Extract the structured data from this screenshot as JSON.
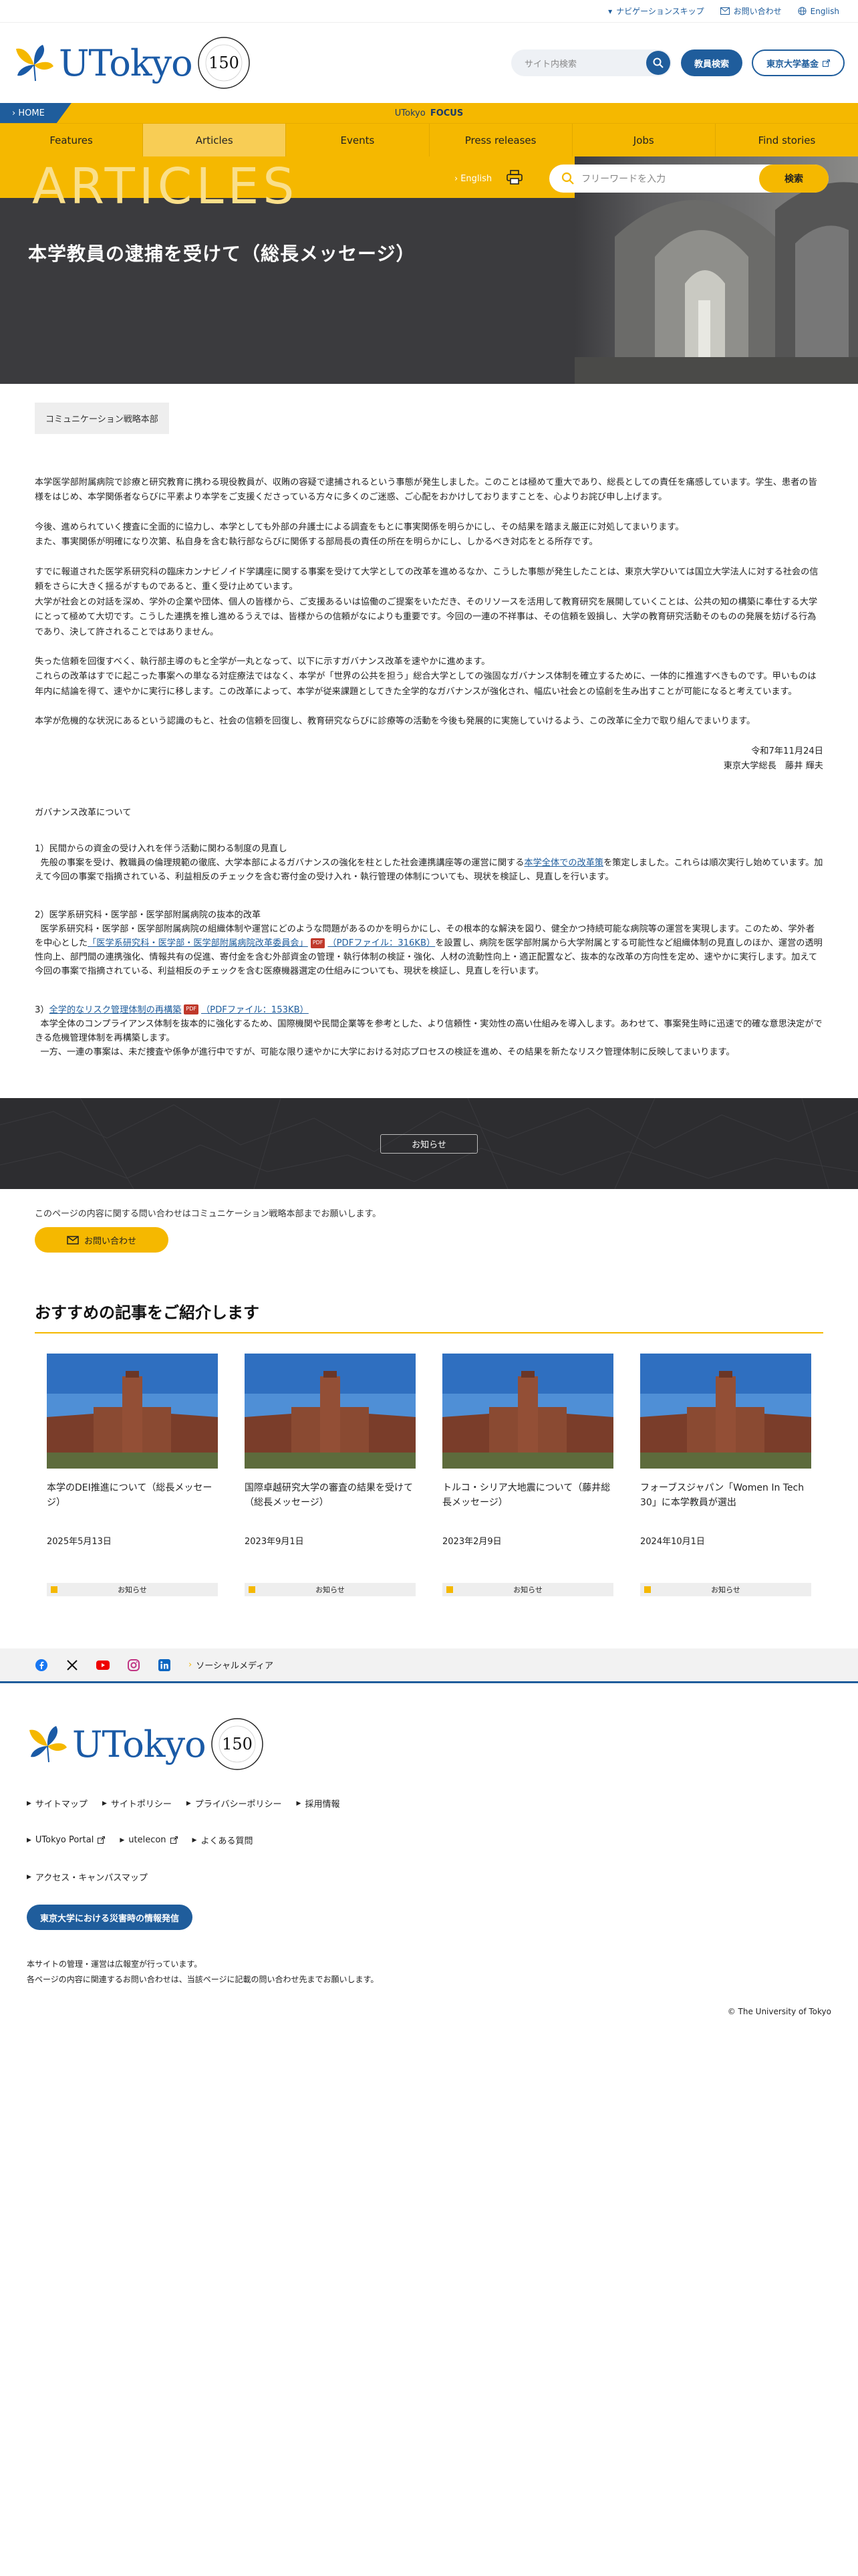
{
  "util_bar": {
    "nav_skip": "ナビゲーションスキップ",
    "contact": "お問い合わせ",
    "english": "English"
  },
  "header": {
    "logo_text": "UTokyo",
    "site_search_placeholder": "サイト内検索",
    "faculty_search": "教員検索",
    "fund": "東京大学基金"
  },
  "focus_bar": {
    "home": "HOME",
    "prefix": "UTokyo",
    "focus": "FOCUS"
  },
  "nav": {
    "items": [
      "Features",
      "Articles",
      "Events",
      "Press releases",
      "Jobs",
      "Find stories"
    ],
    "active": "Articles"
  },
  "hero": {
    "section": "ARTICLES",
    "english": "English",
    "search_placeholder": "フリーワードを入力",
    "search_button": "検索",
    "title": "本学教員の逮捕を受けて（総長メッセージ）"
  },
  "article": {
    "dept": "コミュニケーション戦略本部",
    "paragraphs": [
      [
        "本学医学部附属病院で診療と研究教育に携わる現役教員が、収賄の容疑で逮捕されるという事態が発生しました。このことは極めて重大であり、総長としての責任を痛感しています。学生、患者の皆様をはじめ、本学関係者ならびに平素より本学をご支援くださっている方々に多くのご迷惑、ご心配をおかけしておりますことを、心よりお詫び申し上げます。"
      ],
      [
        "今後、進められていく捜査に全面的に協力し、本学としても外部の弁護士による調査をもとに事実関係を明らかにし、その結果を踏まえ厳正に対処してまいります。",
        "また、事実関係が明確になり次第、私自身を含む執行部ならびに関係する部局長の責任の所在を明らかにし、しかるべき対応をとる所存です。"
      ],
      [
        "すでに報道された医学系研究科の臨床カンナビノイド学講座に関する事案を受けて大学としての改革を進めるなか、こうした事態が発生したことは、東京大学ひいては国立大学法人に対する社会の信頼をさらに大きく揺るがすものであると、重く受け止めています。",
        "大学が社会との対話を深め、学外の企業や団体、個人の皆様から、ご支援あるいは協働のご提案をいただき、そのリソースを活用して教育研究を展開していくことは、公共の知の構築に奉仕する大学にとって極めて大切です。こうした連携を推し進めるうえでは、皆様からの信頼がなによりも重要です。今回の一連の不祥事は、その信頼を毀損し、大学の教育研究活動そのものの発展を妨げる行為であり、決して許されることではありません。"
      ],
      [
        "失った信頼を回復すべく、執行部主導のもと全学が一丸となって、以下に示すガバナンス改革を速やかに進めます。",
        "これらの改革はすでに起こった事案への単なる対症療法ではなく、本学が「世界の公共を担う」総合大学としての強固なガバナンス体制を確立するために、一体的に推進すべきものです。甲いものは年内に結論を得て、速やかに実行に移します。この改革によって、本学が従来課題としてきた全学的なガバナンスが強化され、幅広い社会との協創を生み出すことが可能になると考えています。"
      ],
      [
        "本学が危機的な状況にあるという認識のもと、社会の信頼を回復し、教育研究ならびに診療等の活動を今後も発展的に実施していけるよう、この改革に全力で取り組んでまいります。"
      ]
    ],
    "date": "令和7年11月24日",
    "signature": "東京大学総長　藤井 輝夫",
    "gov_heading": "ガバナンス改革について",
    "gov_items": [
      {
        "title": "1）民間からの資金の受け入れを伴う活動に関わる制度の見直し",
        "before": "先般の事案を受け、教職員の倫理規範の徹底、大学本部によるガバナンスの強化を柱とした社会連携講座等の運営に関する",
        "link": "本学全体での改革策",
        "after": "を策定しました。これらは順次実行し始めています。加えて今回の事案で指摘されている、利益相反のチェックを含む寄付金の受け入れ・執行管理の体制についても、現状を検証し、見直しを行います。"
      },
      {
        "title": "2）医学系研究科・医学部・医学部附属病院の抜本的改革",
        "before": "医学系研究科・医学部・医学部附属病院の組織体制や運営にどのような問題があるのかを明らかにし、その根本的な解決を図り、健全かつ持続可能な病院等の運営を実現します。このため、学外者を中心とした",
        "link": "「医学系研究科・医学部・医学部附属病院改革委員会」",
        "pdf": "PDF",
        "link_size": "（PDFファイル：316KB）",
        "after": "を設置し、病院を医学部附属から大学附属とする可能性など組織体制の見直しのほか、運営の透明性向上、部門間の連携強化、情報共有の促進、寄付金を含む外部資金の管理・執行体制の検証・強化、人材の流動性向上・適正配置など、抜本的な改革の方向性を定め、速やかに実行します。加えて今回の事案で指摘されている、利益相反のチェックを含む医療機器選定の仕組みについても、現状を検証し、見直しを行います。"
      },
      {
        "title_prefix": "3）",
        "link": "全学的なリスク管理体制の再構築",
        "pdf": "PDF",
        "link_size": "（PDFファイル：153KB）",
        "text1": "本学全体のコンプライアンス体制を抜本的に強化するため、国際機関や民間企業等を参考とした、より信頼性・実効性の高い仕組みを導入します。あわせて、事案発生時に迅速で的確な意思決定ができる危機管理体制を再構築します。",
        "text2": "一方、一連の事案は、未だ捜査や係争が進行中ですが、可能な限り速やかに大学における対応プロセスの検証を進め、その結果を新たなリスク管理体制に反映してまいります。"
      }
    ]
  },
  "category_band": {
    "label": "お知らせ"
  },
  "contact": {
    "text": "このページの内容に関する問い合わせはコミュニケーション戦略本部までお願いします。",
    "button": "お問い合わせ"
  },
  "recommend": {
    "title": "おすすめの記事をご紹介します",
    "cards": [
      {
        "title": "本学のDEI推進について（総長メッセージ）",
        "date": "2025年5月13日",
        "category": "お知らせ"
      },
      {
        "title": "国際卓越研究大学の審査の結果を受けて（総長メッセージ）",
        "date": "2023年9月1日",
        "category": "お知らせ"
      },
      {
        "title": "トルコ・シリア大地震について（藤井総長メッセージ）",
        "date": "2023年2月9日",
        "category": "お知らせ"
      },
      {
        "title": "フォーブスジャパン「Women In Tech 30」に本学教員が選出",
        "date": "2024年10月1日",
        "category": "お知らせ"
      }
    ]
  },
  "social": {
    "label": "ソーシャルメディア"
  },
  "footer": {
    "logo_text": "UTokyo",
    "links_row1": [
      "サイトマップ",
      "サイトポリシー",
      "プライバシーポリシー",
      "採用情報"
    ],
    "links_row2": [
      "UTokyo Portal",
      "utelecon",
      "よくある質問"
    ],
    "links_row3": [
      "アクセス・キャンパスマップ"
    ],
    "disaster": "東京大学における災害時の情報発信",
    "note1": "本サイトの管理・運営は広報室が行っています。",
    "note2": "各ページの内容に関連するお問い合わせは、当該ページに記載の問い合わせ先までお願いします。",
    "copyright": "© The University of Tokyo"
  },
  "colors": {
    "brand_blue": "#1f5d9c",
    "brand_yellow": "#f5b800",
    "hero_dark": "#3b3b3e"
  },
  "icons": [
    "ginkgo-logo-icon",
    "anniversary-150-icon",
    "search-icon",
    "mail-icon",
    "globe-icon",
    "external-link-icon",
    "print-icon",
    "facebook-icon",
    "x-icon",
    "youtube-icon",
    "instagram-icon",
    "linkedin-icon",
    "pdf-icon"
  ]
}
